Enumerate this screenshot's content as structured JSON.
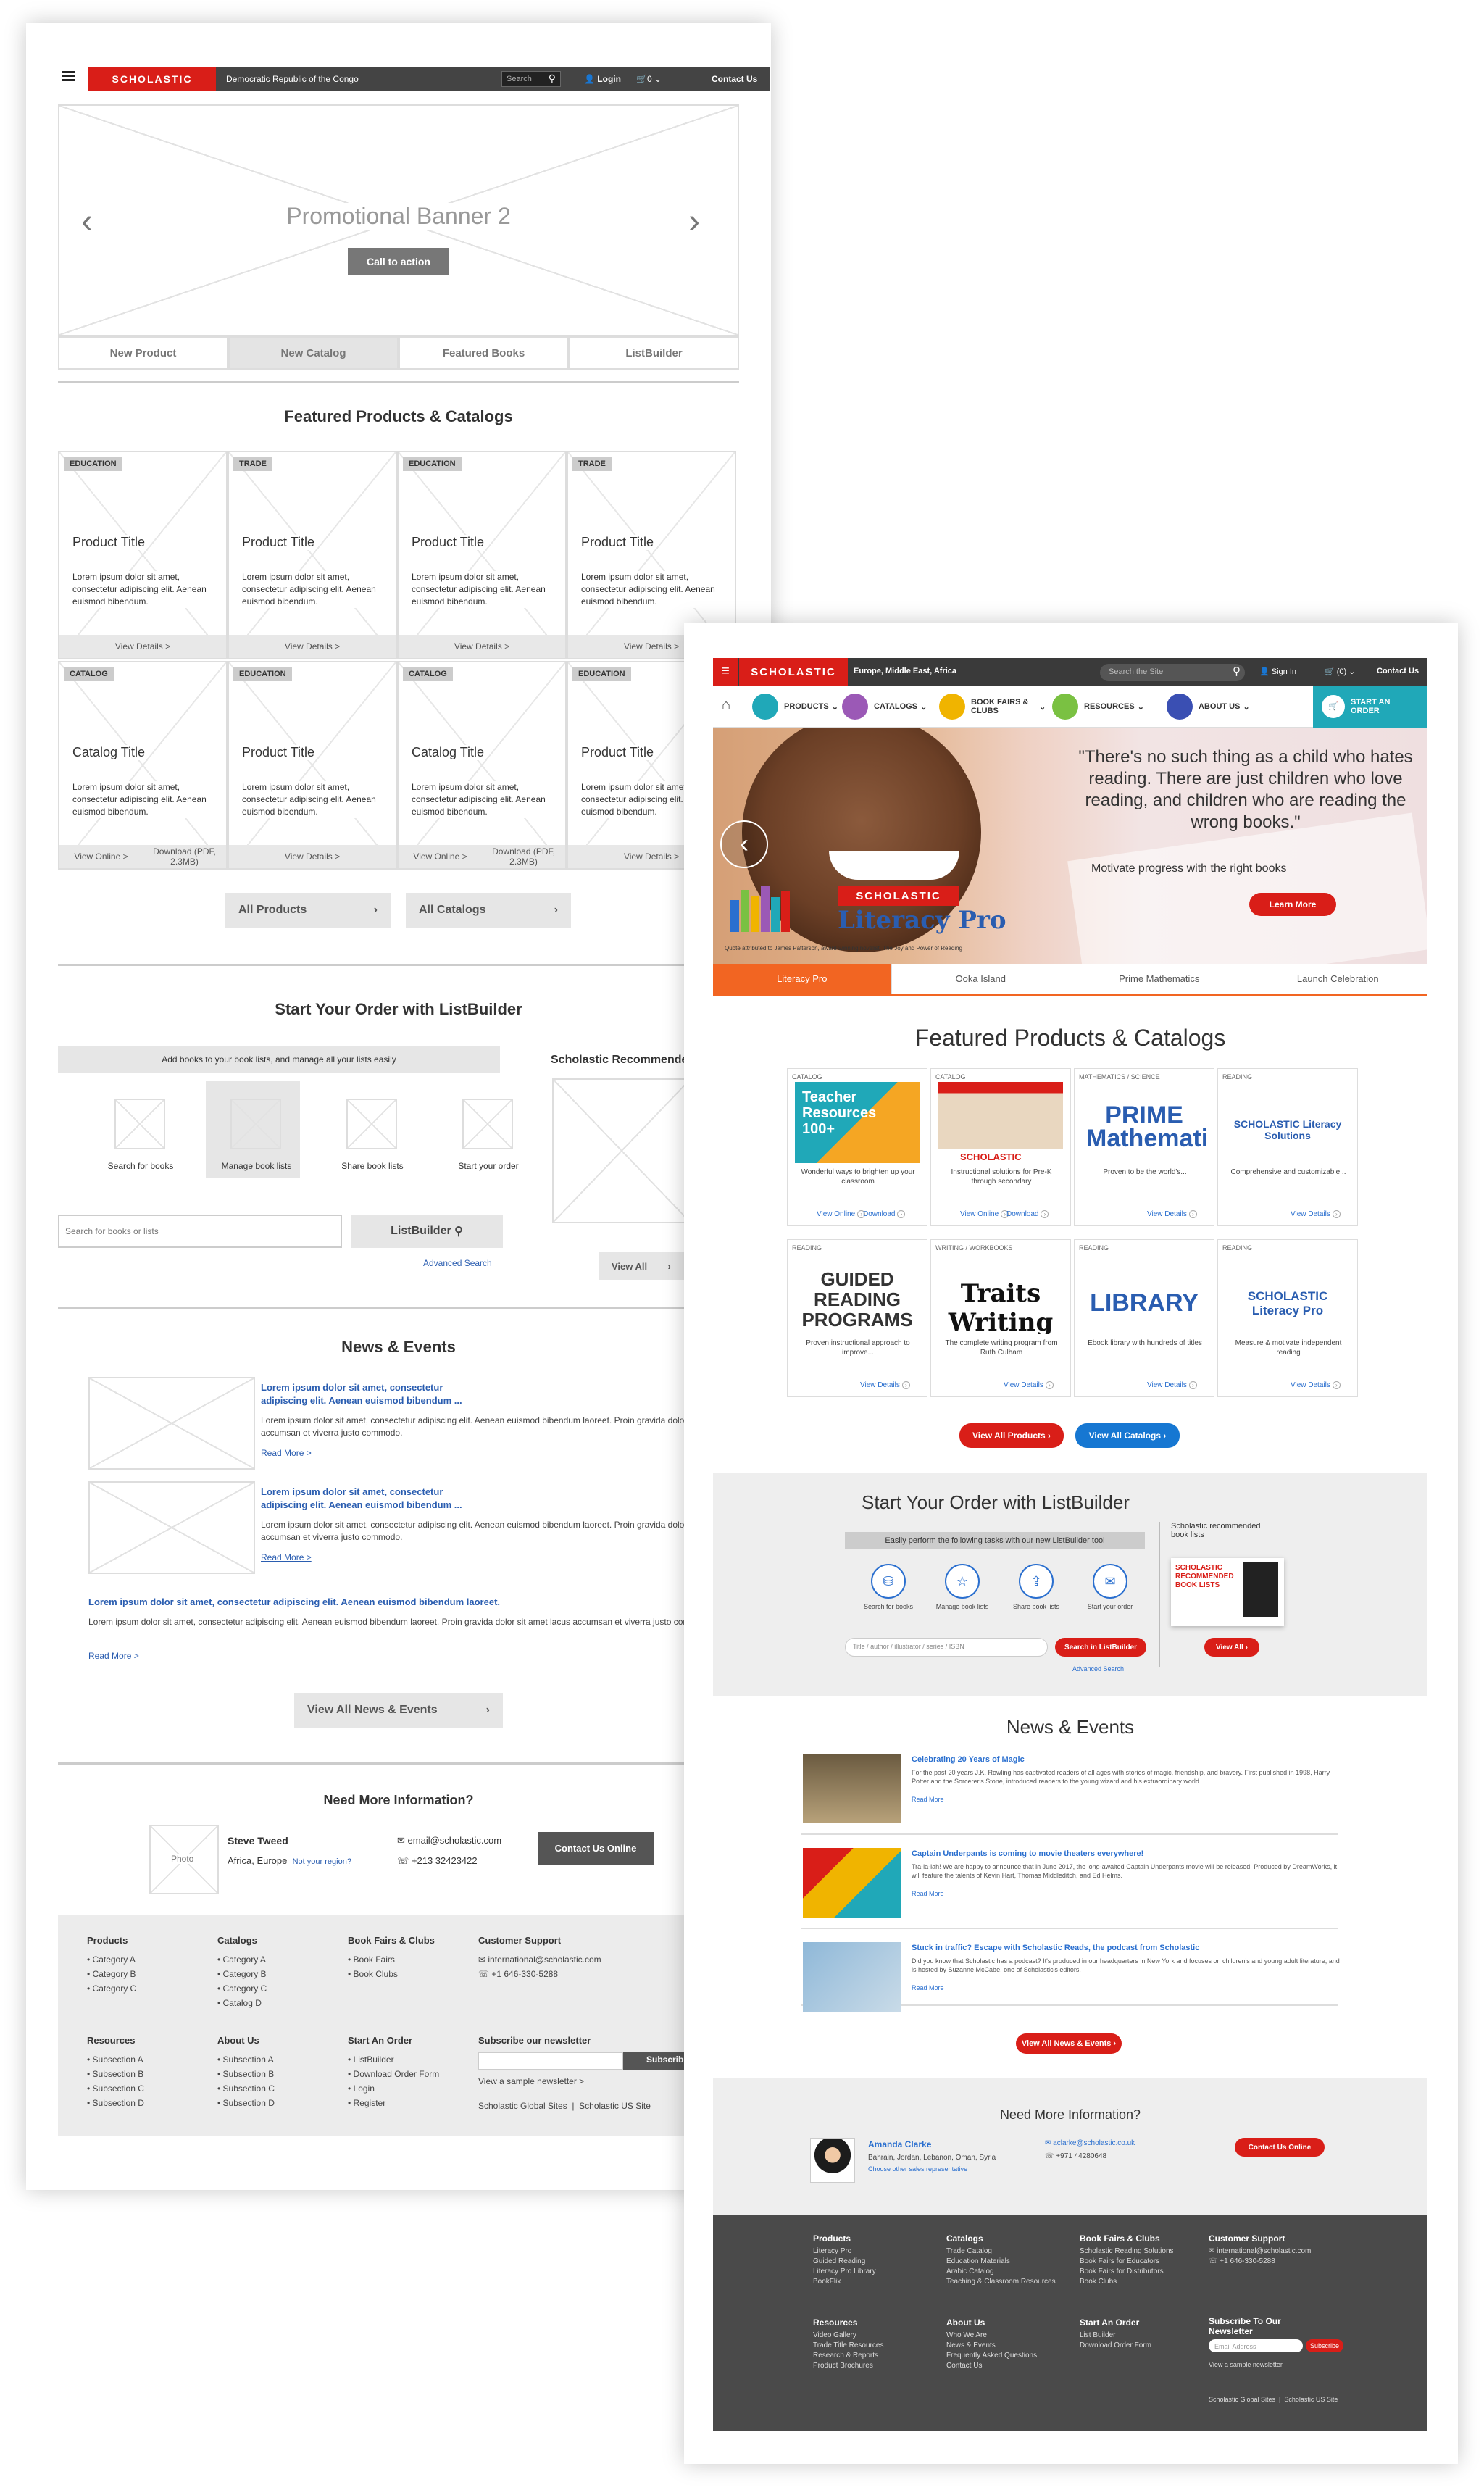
{
  "wireframe": {
    "header": {
      "brand": "SCHOLASTIC",
      "region": "Democratic Republic of the Congo",
      "search": "Search",
      "login": "Login",
      "cart": "0",
      "contact": "Contact Us"
    },
    "banner": {
      "title": "Promotional Banner 2",
      "cta": "Call to action"
    },
    "tabs": [
      "New Product",
      "New Catalog",
      "Featured Books",
      "ListBuilder"
    ],
    "featured": {
      "heading": "Featured Products & Catalogs",
      "cards": [
        {
          "tag": "EDUCATION",
          "title": "Product Title",
          "desc": "Lorem ipsum dolor sit amet, consectetur adipiscing elit. Aenean euismod bibendum.",
          "links": [
            "View Details >"
          ]
        },
        {
          "tag": "TRADE",
          "title": "Product Title",
          "desc": "Lorem ipsum dolor sit amet, consectetur adipiscing elit. Aenean euismod bibendum.",
          "links": [
            "View Details >"
          ]
        },
        {
          "tag": "EDUCATION",
          "title": "Product Title",
          "desc": "Lorem ipsum dolor sit amet, consectetur adipiscing elit. Aenean euismod bibendum.",
          "links": [
            "View Details >"
          ]
        },
        {
          "tag": "TRADE",
          "title": "Product Title",
          "desc": "Lorem ipsum dolor sit amet, consectetur adipiscing elit. Aenean euismod bibendum.",
          "links": [
            "View Details >"
          ]
        },
        {
          "tag": "CATALOG",
          "title": "Catalog Title",
          "desc": "Lorem ipsum dolor sit amet, consectetur adipiscing elit. Aenean euismod bibendum.",
          "links": [
            "View Online >",
            "Download (PDF, 2.3MB)"
          ]
        },
        {
          "tag": "EDUCATION",
          "title": "Product Title",
          "desc": "Lorem ipsum dolor sit amet, consectetur adipiscing elit. Aenean euismod bibendum.",
          "links": [
            "View Details >"
          ]
        },
        {
          "tag": "CATALOG",
          "title": "Catalog Title",
          "desc": "Lorem ipsum dolor sit amet, consectetur adipiscing elit. Aenean euismod bibendum.",
          "links": [
            "View Online >",
            "Download (PDF, 2.3MB)"
          ]
        },
        {
          "tag": "EDUCATION",
          "title": "Product Title",
          "desc": "Lorem ipsum dolor sit amet, consectetur adipiscing elit. Aenean euismod bibendum.",
          "links": [
            "View Details >"
          ]
        }
      ],
      "all_products": "All Products",
      "all_catalogs": "All Catalogs"
    },
    "listbuilder": {
      "heading": "Start Your Order with ListBuilder",
      "intro": "Add books to your book lists, and manage all your lists easily",
      "steps": [
        "Search for books",
        "Manage book lists",
        "Share book lists",
        "Start your order"
      ],
      "placeholder": "Search for books or lists",
      "button": "ListBuilder",
      "advanced": "Advanced Search",
      "rec_heading": "Scholastic Recommended",
      "view_all": "View All"
    },
    "news": {
      "heading": "News & Events",
      "items": [
        {
          "title": "Lorem ipsum dolor sit amet, consectetur adipiscing elit. Aenean euismod bibendum ...",
          "body": "Lorem ipsum dolor sit amet, consectetur adipiscing elit. Aenean euismod bibendum laoreet. Proin gravida dolor sit amet lacus accumsan et viverra justo commodo.",
          "more": "Read More >"
        },
        {
          "title": "Lorem ipsum dolor sit amet, consectetur adipiscing elit. Aenean euismod bibendum ...",
          "body": "Lorem ipsum dolor sit amet, consectetur adipiscing elit. Aenean euismod bibendum laoreet. Proin gravida dolor sit amet lacus accumsan et viverra justo commodo.",
          "more": "Read More >"
        },
        {
          "title": "Lorem ipsum dolor sit amet, consectetur adipiscing elit. Aenean euismod bibendum laoreet.",
          "body": "Lorem ipsum dolor sit amet, consectetur adipiscing elit. Aenean euismod bibendum laoreet. Proin gravida dolor sit amet lacus accumsan et viverra justo commodo.",
          "more": "Read More >"
        }
      ],
      "view_all": "View All News & Events"
    },
    "contact": {
      "heading": "Need More Information?",
      "photo": "Photo",
      "name": "Steve Tweed",
      "region": "Africa, Europe",
      "not_region": "Not your region?",
      "email": "email@scholastic.com",
      "phone": "+213 32423422",
      "button": "Contact Us Online"
    },
    "footer": {
      "cols": [
        {
          "h": "Products",
          "items": [
            "• Category A",
            "• Category B",
            "• Category C"
          ]
        },
        {
          "h": "Catalogs",
          "items": [
            "• Category A",
            "• Category B",
            "• Category C",
            "• Catalog D"
          ]
        },
        {
          "h": "Book Fairs & Clubs",
          "items": [
            "• Book Fairs",
            "• Book Clubs"
          ]
        },
        {
          "h": "Resources",
          "items": [
            "• Subsection A",
            "• Subsection B",
            "• Subsection C",
            "• Subsection D"
          ]
        },
        {
          "h": "About Us",
          "items": [
            "• Subsection A",
            "• Subsection B",
            "• Subsection C",
            "• Subsection D"
          ]
        },
        {
          "h": "Start An Order",
          "items": [
            "• ListBuilder",
            "• Download Order Form",
            "• Login",
            "• Register"
          ]
        }
      ],
      "support": {
        "h": "Customer Support",
        "email": "international@scholastic.com",
        "phone": "+1 646-330-5288"
      },
      "newsletter": {
        "h": "Subscribe our newsletter",
        "button": "Subscribe",
        "sample": "View a sample newsletter >"
      },
      "sites": "Scholastic Global Sites  |  Scholastic US Site"
    }
  },
  "hifi": {
    "header": {
      "brand": "SCHOLASTIC",
      "region": "Europe, Middle East, Africa",
      "search": "Search the Site",
      "signin": "Sign In",
      "cart": "(0)",
      "contact": "Contact Us"
    },
    "nav": [
      {
        "label": "PRODUCTS",
        "color": "#20a8b8"
      },
      {
        "label": "CATALOGS",
        "color": "#9b59b6"
      },
      {
        "label": "BOOK FAIRS & CLUBS",
        "color": "#f0b400"
      },
      {
        "label": "RESOURCES",
        "color": "#7ac142"
      },
      {
        "label": "ABOUT US",
        "color": "#3a4fb3"
      }
    ],
    "start_order": "START AN ORDER",
    "hero": {
      "quote": "\"There's no such thing as a child who hates reading. There are just children who love reading, and children who are reading the wrong books.\"",
      "sub": "Motivate progress with the right books",
      "cta": "Learn More",
      "brand": "SCHOLASTIC",
      "product": "Literacy Pro",
      "credit": "Quote attributed to James Patterson, award-winning novelist, The Joy and Power of Reading"
    },
    "tabs": [
      "Literacy Pro",
      "Ooka Island",
      "Prime Mathematics",
      "Launch Celebration"
    ],
    "featured": {
      "heading": "Featured Products & Catalogs",
      "cards": [
        {
          "tag": "CATALOG",
          "art": "Teacher Resources 100+",
          "desc": "Wonderful ways to brighten up your classroom",
          "links": [
            "View Online",
            "Download"
          ]
        },
        {
          "tag": "CATALOG",
          "art": "SCHOLASTIC EDUCATION",
          "desc": "Instructional solutions for Pre-K through secondary",
          "links": [
            "View Online",
            "Download"
          ]
        },
        {
          "tag": "MATHEMATICS / SCIENCE",
          "art": "PRIME Mathematics",
          "desc": "Proven to be the world's...",
          "links": [
            "View Details"
          ]
        },
        {
          "tag": "READING",
          "art": "SCHOLASTIC Literacy Solutions",
          "desc": "Comprehensive and customizable...",
          "links": [
            "View Details"
          ]
        },
        {
          "tag": "READING",
          "art": "GUIDED READING PROGRAMS",
          "desc": "Proven instructional approach to improve...",
          "links": [
            "View Details"
          ]
        },
        {
          "tag": "WRITING / WORKBOOKS",
          "art": "Traits Writing",
          "desc": "The complete writing program from Ruth Culham",
          "links": [
            "View Details"
          ]
        },
        {
          "tag": "READING",
          "art": "LIBRARY",
          "desc": "Ebook library with hundreds of titles",
          "links": [
            "View Details"
          ]
        },
        {
          "tag": "READING",
          "art": "SCHOLASTIC Literacy Pro",
          "desc": "Measure & motivate independent reading",
          "links": [
            "View Details"
          ]
        }
      ],
      "all_products": "View All Products",
      "all_catalogs": "View All Catalogs"
    },
    "listbuilder": {
      "heading": "Start Your Order with ListBuilder",
      "intro": "Easily perform the following tasks with our new ListBuilder tool",
      "steps": [
        "Search for books",
        "Manage book lists",
        "Share book lists",
        "Start your order"
      ],
      "placeholder": "Title / author / illustrator / series / ISBN",
      "button": "Search in ListBuilder",
      "advanced": "Advanced Search",
      "rec_heading": "Scholastic recommended book lists",
      "rec_art": "SCHOLASTIC RECOMMENDED BOOK LISTS",
      "view_all": "View All"
    },
    "news": {
      "heading": "News & Events",
      "items": [
        {
          "title": "Celebrating 20 Years of Magic",
          "body": "For the past 20 years J.K. Rowling has captivated readers of all ages with stories of magic, friendship, and bravery. First published in 1998, Harry Potter and the Sorcerer's Stone, introduced readers to the young wizard and his extraordinary world.",
          "more": "Read More"
        },
        {
          "title": "Captain Underpants is coming to movie theaters everywhere!",
          "body": "Tra-la-lah! We are happy to announce that in June 2017, the long-awaited Captain Underpants movie will be released. Produced by DreamWorks, it will feature the talents of Kevin Hart, Thomas Middleditch, and Ed Helms.",
          "more": "Read More"
        },
        {
          "title": "Stuck in traffic? Escape with Scholastic Reads, the podcast from Scholastic",
          "body": "Did you know that Scholastic has a podcast? It's produced in our headquarters in New York and focuses on children's and young adult literature, and is hosted by Suzanne McCabe, one of Scholastic's editors.",
          "more": "Read More"
        }
      ],
      "view_all": "View All News & Events"
    },
    "contact": {
      "heading": "Need More Information?",
      "name": "Amanda Clarke",
      "region": "Bahrain, Jordan, Lebanon, Oman, Syria",
      "choose": "Choose other sales representative",
      "email": "aclarke@scholastic.co.uk",
      "phone": "+971 44280648",
      "button": "Contact Us Online"
    },
    "footer": {
      "cols": [
        {
          "h": "Products",
          "items": [
            "Literacy Pro",
            "Guided Reading",
            "Literacy Pro Library",
            "BookFlix"
          ]
        },
        {
          "h": "Catalogs",
          "items": [
            "Trade Catalog",
            "Education Materials",
            "Arabic Catalog",
            "Teaching & Classroom Resources"
          ]
        },
        {
          "h": "Book Fairs & Clubs",
          "items": [
            "Scholastic Reading Solutions",
            "Book Fairs for Educators",
            "Book Fairs for Distributors",
            "Book Clubs"
          ]
        },
        {
          "h": "Resources",
          "items": [
            "Video Gallery",
            "Trade Title Resources",
            "Research & Reports",
            "Product Brochures"
          ]
        },
        {
          "h": "About Us",
          "items": [
            "Who We Are",
            "News & Events",
            "Frequently Asked Questions",
            "Contact Us"
          ]
        },
        {
          "h": "Start An Order",
          "items": [
            "List Builder",
            "Download Order Form"
          ]
        }
      ],
      "support": {
        "h": "Customer Support",
        "email": "international@scholastic.com",
        "phone": "+1 646-330-5288"
      },
      "newsletter": {
        "h": "Subscribe To Our Newsletter",
        "placeholder": "Email Address",
        "button": "Subscribe",
        "sample": "View a sample newsletter"
      },
      "sites": "Scholastic Global Sites  |  Scholastic US Site"
    }
  }
}
